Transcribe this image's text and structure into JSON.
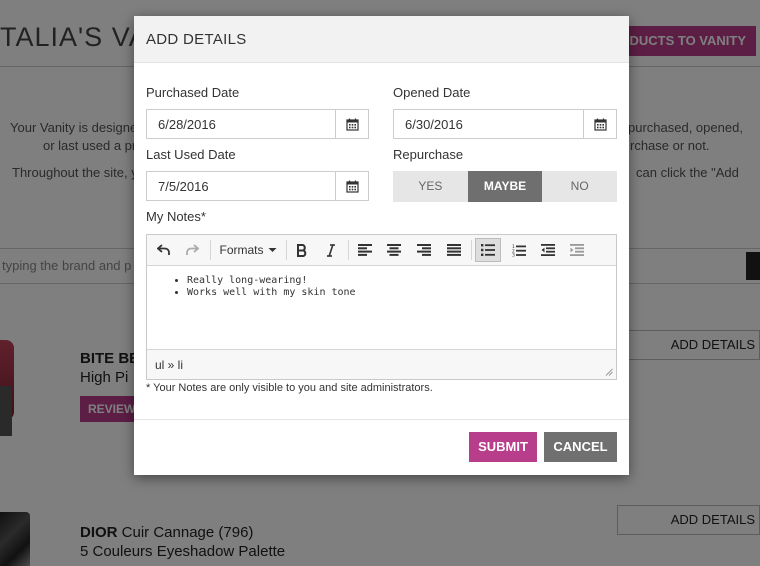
{
  "background": {
    "page_title": "TALIA'S VAN",
    "add_products_label": "ODUCTS TO VANITY",
    "intro_line1_left": "Your Vanity is designe",
    "intro_line1_right": "purchased, opened,",
    "intro_line2_left": "or last used a pr",
    "intro_line2_right": "rchase or not.",
    "intro_line3_left": "Throughout the site, y",
    "intro_line3_right": "can click the \"Add",
    "search_placeholder": "typing the brand and p",
    "products": [
      {
        "brand": "BITE BE",
        "name": "High Pi",
        "review_label": "REVIEW",
        "add_details_label": "ADD DETAILS"
      },
      {
        "brand": "DIOR",
        "name_suffix": "Cuir Cannage (796)",
        "name": "5 Couleurs Eyeshadow Palette",
        "add_details_label": "ADD DETAILS"
      }
    ]
  },
  "modal": {
    "title": "ADD DETAILS",
    "purchased_date": {
      "label": "Purchased Date",
      "value": "6/28/2016"
    },
    "opened_date": {
      "label": "Opened Date",
      "value": "6/30/2016"
    },
    "last_used_date": {
      "label": "Last Used Date",
      "value": "7/5/2016"
    },
    "repurchase": {
      "label": "Repurchase",
      "options": [
        "YES",
        "MAYBE",
        "NO"
      ],
      "selected": "MAYBE"
    },
    "notes": {
      "label": "My Notes*",
      "toolbar": {
        "formats_label": "Formats",
        "buttons": [
          "undo-icon",
          "redo-icon",
          "bold-icon",
          "italic-icon",
          "align-left-icon",
          "align-center-icon",
          "align-right-icon",
          "align-justify-icon",
          "bullet-list-icon",
          "numbered-list-icon",
          "outdent-icon",
          "indent-icon"
        ]
      },
      "items": [
        "Really long-wearing!",
        "Works well with my skin tone"
      ],
      "element_path": "ul » li",
      "hint": "* Your Notes are only visible to you and site administrators."
    },
    "submit_label": "SUBMIT",
    "cancel_label": "CANCEL"
  },
  "colors": {
    "accent": "#b83d8a",
    "selected_toggle": "#6f6f6f",
    "cancel": "#707070"
  }
}
